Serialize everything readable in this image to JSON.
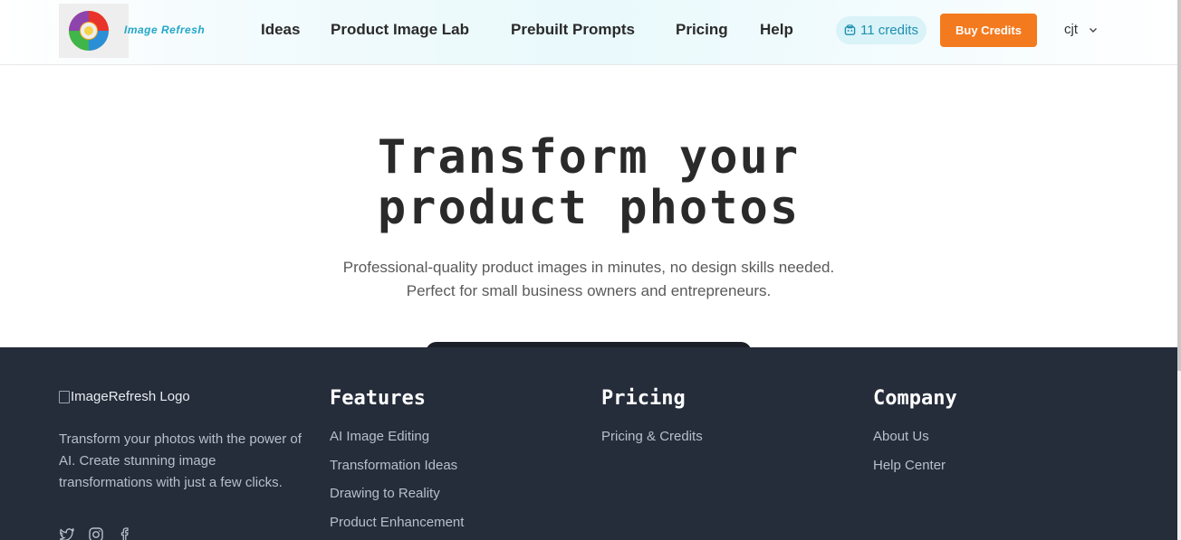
{
  "header": {
    "logo_text": "Image Refresh",
    "nav": [
      "Ideas",
      "Product Image Lab",
      "Prebuilt Prompts",
      "Pricing",
      "Help"
    ],
    "credits_label": "11 credits",
    "buy_label": "Buy Credits",
    "user_name": "cjt"
  },
  "hero": {
    "title_line1": "Transform your",
    "title_line2": "product photos",
    "subtitle_line1": "Professional-quality product images in minutes, no design skills needed.",
    "subtitle_line2": "Perfect for small business owners and entrepreneurs."
  },
  "footer": {
    "logo_alt": "ImageRefresh Logo",
    "description": "Transform your photos with the power of AI. Create stunning image transformations with just a few clicks.",
    "columns": [
      {
        "title": "Features",
        "items": [
          "AI Image Editing",
          "Transformation Ideas",
          "Drawing to Reality",
          "Product Enhancement"
        ]
      },
      {
        "title": "Pricing",
        "items": [
          "Pricing & Credits"
        ]
      },
      {
        "title": "Company",
        "items": [
          "About Us",
          "Help Center"
        ]
      }
    ]
  },
  "colors": {
    "accent_orange": "#f47a1f",
    "footer_bg": "#252c3a",
    "credits_pill_bg": "#d9f3f8",
    "logo_text": "#22a7c9"
  },
  "icons": [
    "logo-swirl-icon",
    "credits-coin-icon",
    "chevron-down-icon",
    "twitter-icon",
    "instagram-icon",
    "facebook-icon"
  ]
}
